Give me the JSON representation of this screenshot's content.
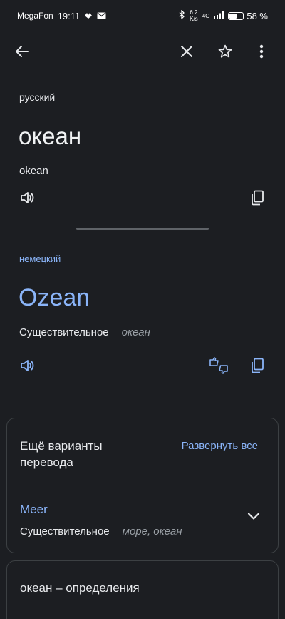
{
  "status_bar": {
    "carrier": "MegaFon",
    "time": "19:11",
    "speed_value": "6.2",
    "speed_unit": "K/s",
    "network": "4G",
    "battery_percent": "58 %",
    "battery_level": 0.58
  },
  "toolbar": {
    "back_icon": "arrow-left-icon",
    "close_icon": "close-icon",
    "star_icon": "star-outline-icon",
    "more_icon": "more-vert-icon"
  },
  "source": {
    "language": "русский",
    "word": "океан",
    "transliteration": "okean"
  },
  "target": {
    "language": "немецкий",
    "word": "Ozean",
    "part_of_speech": "Существительное",
    "meaning": "океан"
  },
  "variants_card": {
    "title": "Ещё варианты перевода",
    "expand_all_label": "Развернуть все",
    "items": [
      {
        "word": "Meer",
        "part_of_speech": "Существительное",
        "meanings": "море, океан"
      }
    ]
  },
  "definition_card": {
    "title": "океан – определения"
  },
  "colors": {
    "background": "#1c1e22",
    "accent": "#8ab4f8",
    "text": "#e8eaed",
    "muted": "#9aa0a6"
  }
}
